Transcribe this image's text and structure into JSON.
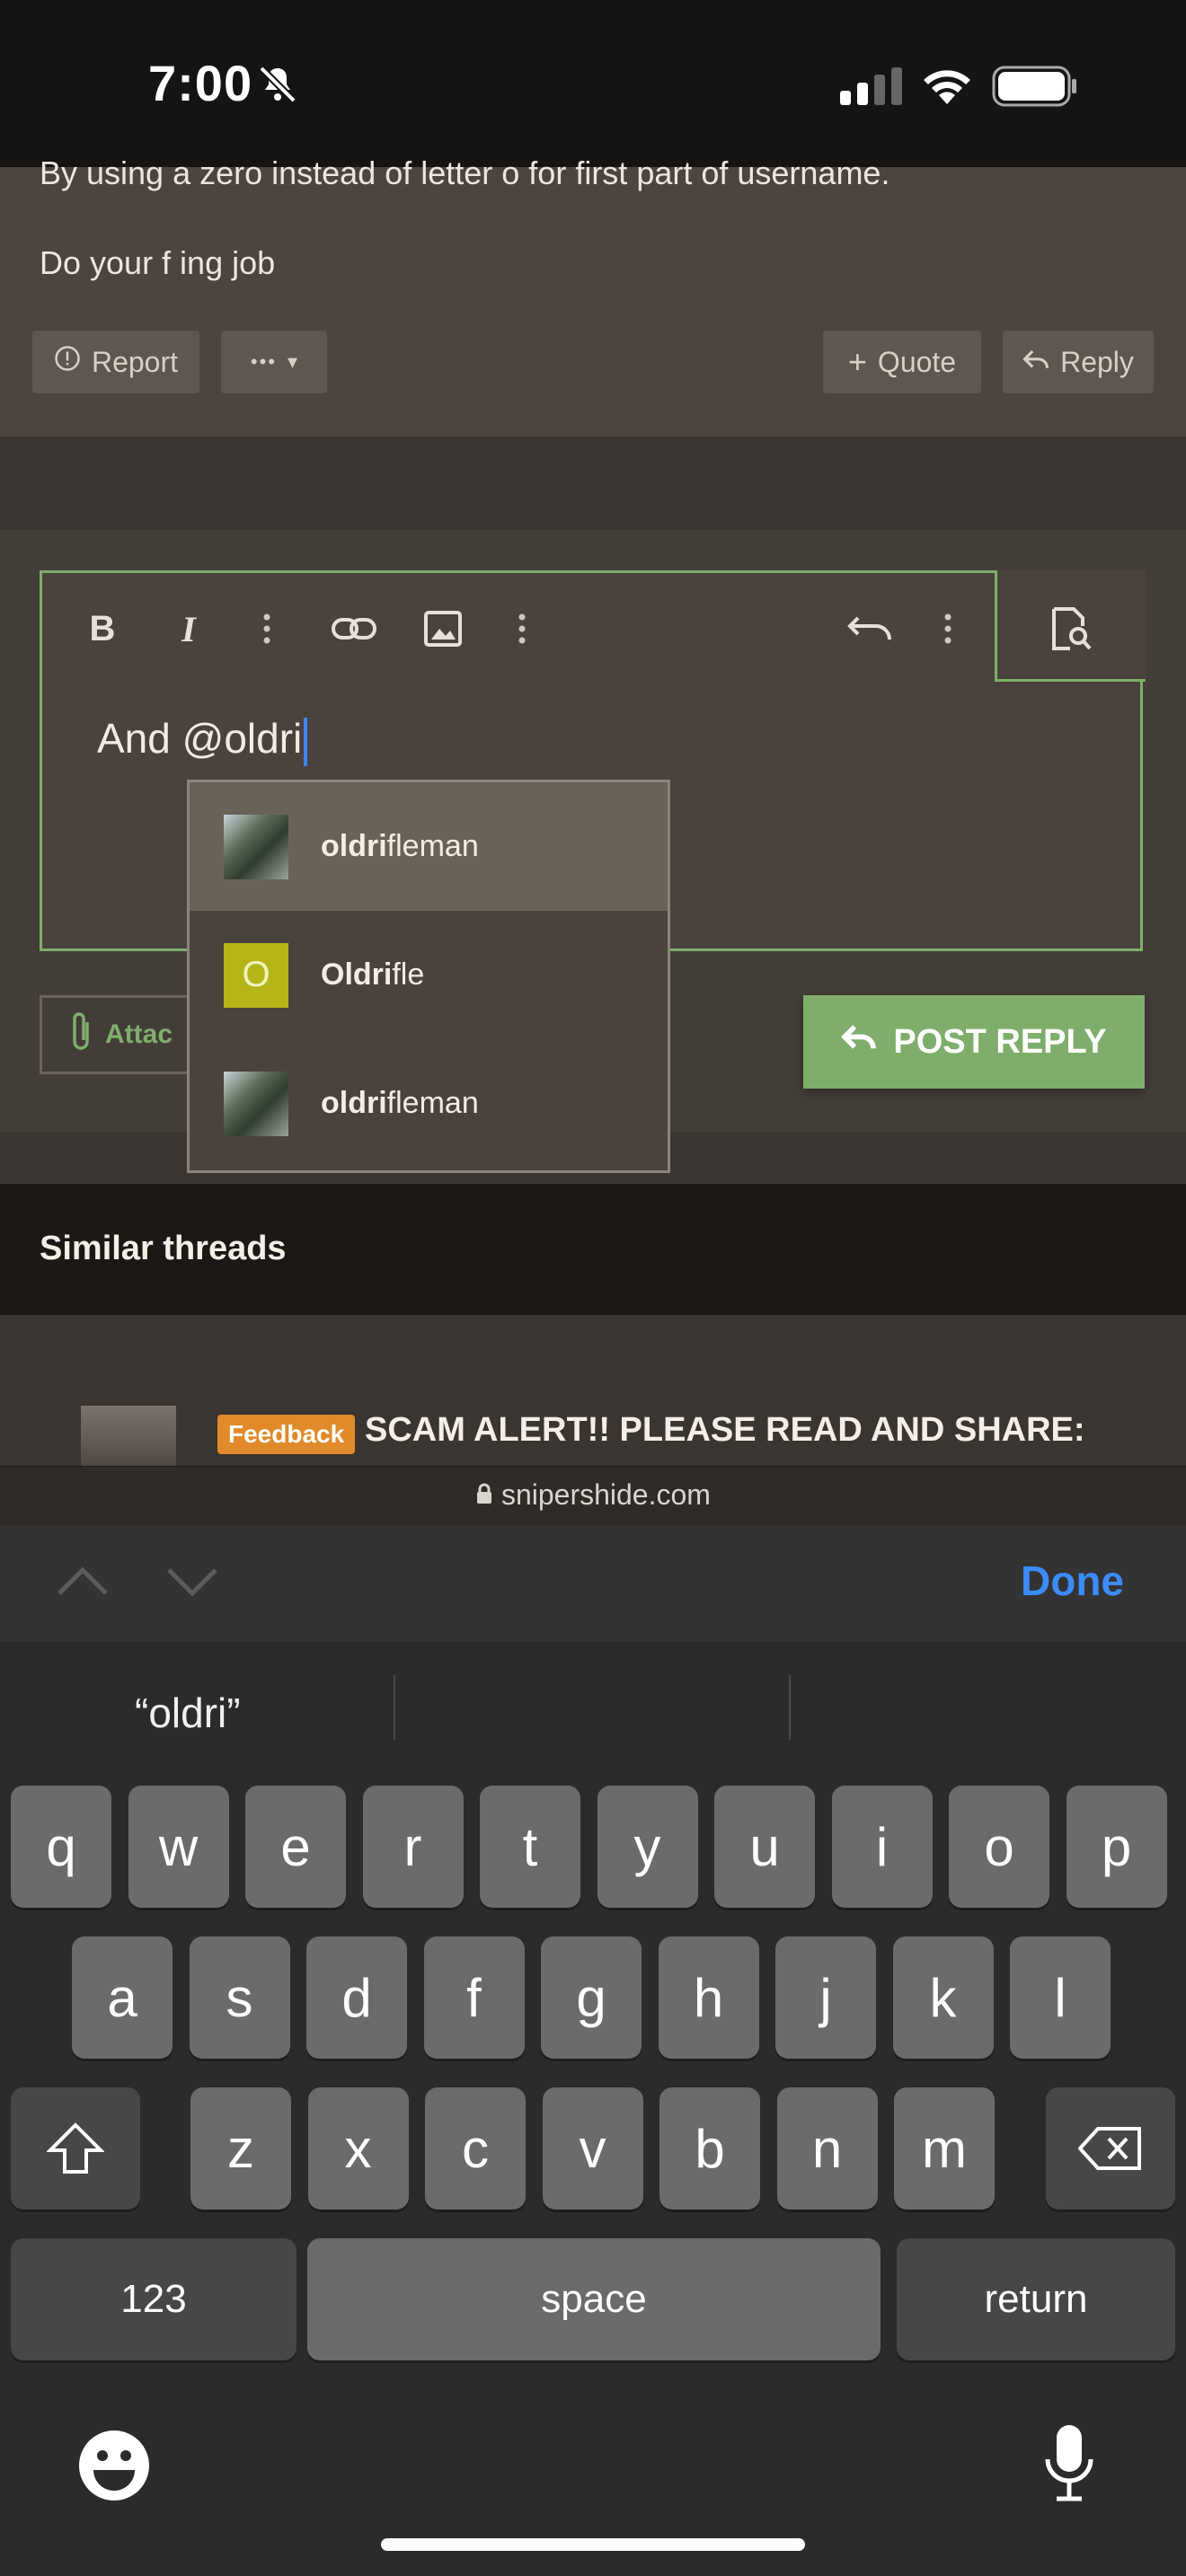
{
  "status_bar": {
    "time": "7:00"
  },
  "post": {
    "line1": "By using a zero instead of letter o for first part of username.",
    "line2": "Do your f ing job",
    "report": "Report",
    "more": "•••",
    "quote": "Quote",
    "reply": "Reply"
  },
  "editor": {
    "text": "And @oldri",
    "attach_label": "Attac",
    "post_reply": "POST REPLY"
  },
  "mention_suggestions": [
    {
      "match": "oldri",
      "rest": "fleman",
      "avatar": "photo"
    },
    {
      "match": "Oldri",
      "rest": "fle",
      "avatar": "letter",
      "letter": "O",
      "color": "#b5b517"
    },
    {
      "match": "oldri",
      "rest": "fleman",
      "avatar": "photo"
    }
  ],
  "similar": {
    "heading": "Similar threads",
    "badge": "Feedback",
    "thread_title": "SCAM ALERT!! PLEASE READ AND SHARE:"
  },
  "browser": {
    "url": "snipershide.com"
  },
  "keyboard": {
    "done": "Done",
    "suggestion": "“oldri”",
    "row1": [
      "q",
      "w",
      "e",
      "r",
      "t",
      "y",
      "u",
      "i",
      "o",
      "p"
    ],
    "row2": [
      "a",
      "s",
      "d",
      "f",
      "g",
      "h",
      "j",
      "k",
      "l"
    ],
    "row3": [
      "z",
      "x",
      "c",
      "v",
      "b",
      "n",
      "m"
    ],
    "numbers": "123",
    "space": "space",
    "return": "return"
  },
  "colors": {
    "accent_green": "#7fae6c",
    "link_blue": "#3b8cff",
    "badge_orange": "#e08a2a"
  }
}
